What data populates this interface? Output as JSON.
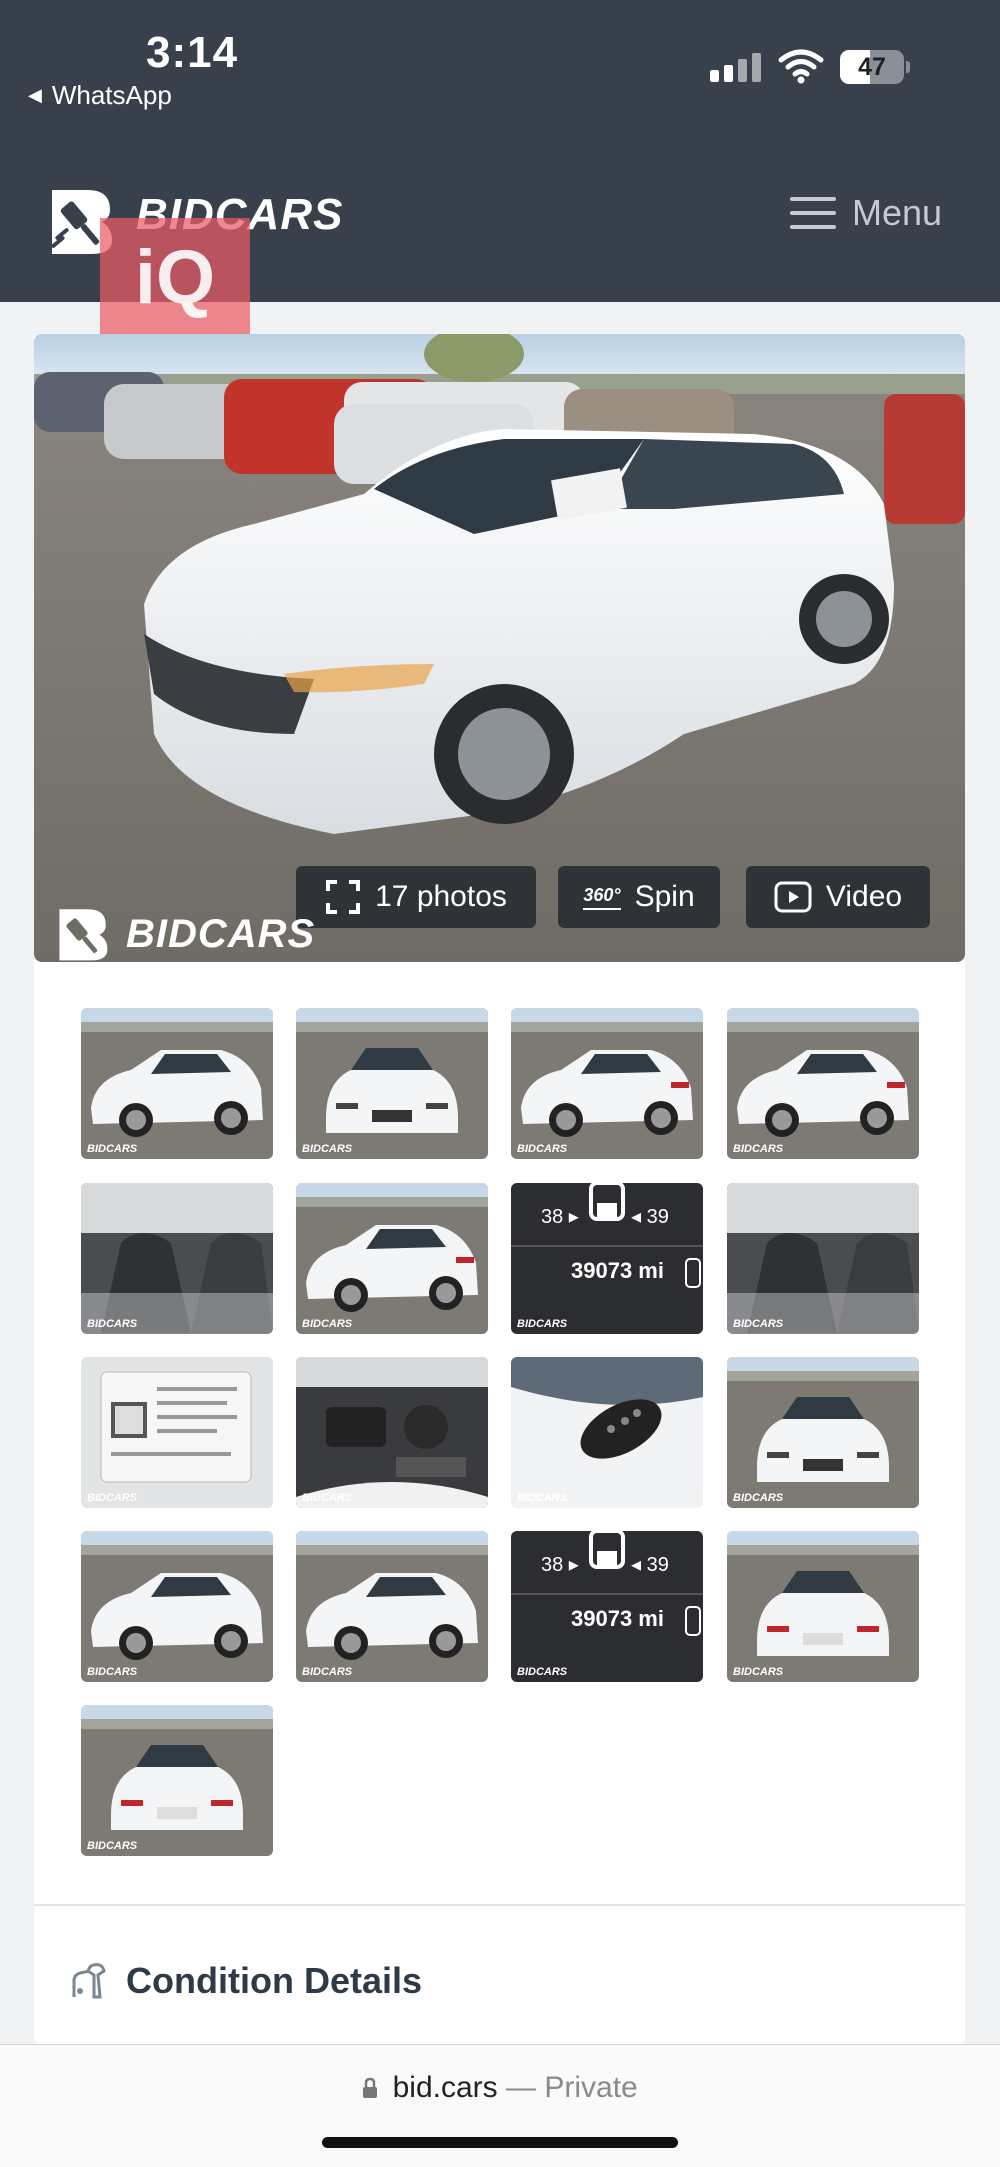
{
  "status_bar": {
    "time": "3:14",
    "back_app": "WhatsApp",
    "battery": "47",
    "battery_level": 0.47
  },
  "header": {
    "brand": "BIDCARS",
    "menu_label": "Menu",
    "overlay_badge": "iQ"
  },
  "gallery": {
    "watermark": "BIDCARS",
    "photos_button": "17 photos",
    "spin_button": "Spin",
    "spin_badge": "360°",
    "video_button": "Video",
    "thumbnails": [
      {
        "kind": "front-left",
        "mark": "BIDCARS"
      },
      {
        "kind": "front",
        "mark": "BIDCARS"
      },
      {
        "kind": "rear-left",
        "mark": "BIDCARS"
      },
      {
        "kind": "rear-left",
        "mark": "BIDCARS"
      },
      {
        "kind": "interior-front",
        "mark": "BIDCARS"
      },
      {
        "kind": "rear-left",
        "mark": "BIDCARS"
      },
      {
        "kind": "odometer",
        "mark": "BIDCARS",
        "left": "38",
        "right": "39",
        "reading": "39073 mi"
      },
      {
        "kind": "interior-rear",
        "mark": "BIDCARS"
      },
      {
        "kind": "label",
        "mark": "BIDCARS"
      },
      {
        "kind": "engine",
        "mark": "BIDCARS"
      },
      {
        "kind": "key",
        "mark": "BIDCARS"
      },
      {
        "kind": "front",
        "mark": "BIDCARS"
      },
      {
        "kind": "side",
        "mark": "BIDCARS"
      },
      {
        "kind": "side",
        "mark": "BIDCARS"
      },
      {
        "kind": "odometer",
        "mark": "BIDCARS",
        "left": "38",
        "right": "39",
        "reading": "39073 mi"
      },
      {
        "kind": "rear",
        "mark": "BIDCARS"
      },
      {
        "kind": "rear-closeup",
        "mark": "BIDCARS"
      }
    ]
  },
  "section": {
    "title": "Condition Details"
  },
  "browser": {
    "domain": "bid.cars",
    "separator": "—",
    "privacy": "Private"
  },
  "colors": {
    "header_bg": "#37404b",
    "card_bg": "#ffffff",
    "page_bg": "#f1f2f4",
    "accent": "#2f3a48"
  }
}
